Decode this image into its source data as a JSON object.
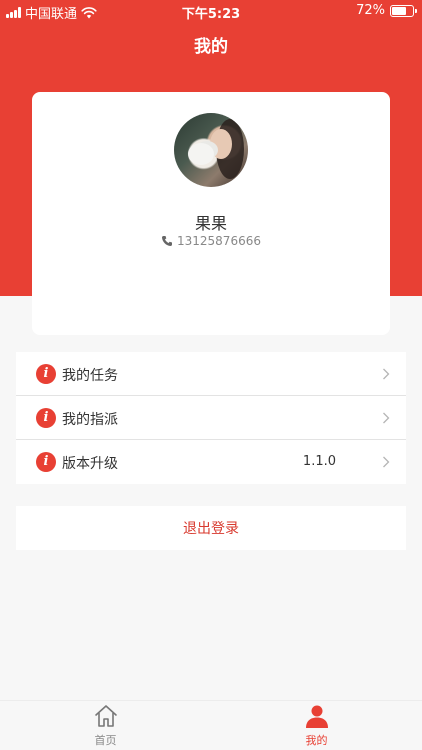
{
  "status_bar": {
    "carrier": "中国联通",
    "time": "下午5:23",
    "battery": "72%",
    "battery_level": 0.72
  },
  "header": {
    "title": "我的"
  },
  "profile": {
    "name": "果果",
    "phone": "13125876666",
    "phone_icon": "phone-icon"
  },
  "menu": {
    "items": [
      {
        "label": "我的任务",
        "value": "",
        "icon": "info-icon"
      },
      {
        "label": "我的指派",
        "value": "",
        "icon": "info-icon"
      },
      {
        "label": "版本升级",
        "value": "1.1.0",
        "icon": "info-icon"
      }
    ]
  },
  "logout": {
    "label": "退出登录"
  },
  "tab_bar": {
    "tabs": [
      {
        "label": "首页",
        "icon": "home-icon",
        "active": false
      },
      {
        "label": "我的",
        "icon": "person-icon",
        "active": true
      }
    ]
  },
  "colors": {
    "accent": "#e84034",
    "logout_text": "#d8392e",
    "background": "#f7f7f7"
  }
}
